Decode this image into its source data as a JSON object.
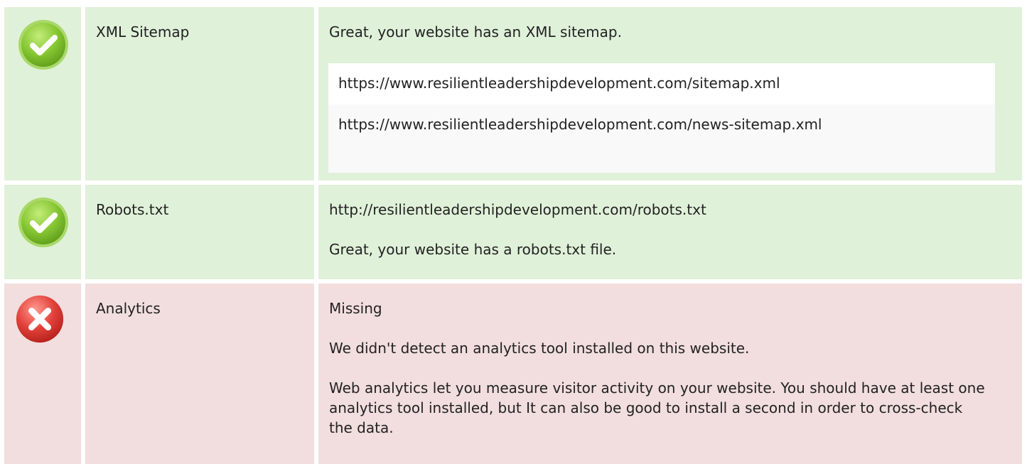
{
  "rows": [
    {
      "status": "pass",
      "icon": "check-circle-icon",
      "label": "XML Sitemap",
      "message": "Great, your website has an XML sitemap.",
      "urls": [
        "https://www.resilientleadershipdevelopment.com/sitemap.xml",
        "https://www.resilientleadershipdevelopment.com/news-sitemap.xml"
      ]
    },
    {
      "status": "pass",
      "icon": "check-circle-icon",
      "label": "Robots.txt",
      "url": "http://resilientleadershipdevelopment.com/robots.txt",
      "message": "Great, your website has a robots.txt file."
    },
    {
      "status": "fail",
      "icon": "error-circle-icon",
      "label": "Analytics",
      "result": "Missing",
      "message": "We didn't detect an analytics tool installed on this website.",
      "advice": "Web analytics let you measure visitor activity on your website. You should have at least one analytics tool installed, but It can also be good to install a second in order to cross-check the data."
    }
  ],
  "colors": {
    "pass_bg": "#e0f1d9",
    "fail_bg": "#f2dede",
    "pass_icon": "#7cc226",
    "fail_icon": "#e2403a"
  }
}
